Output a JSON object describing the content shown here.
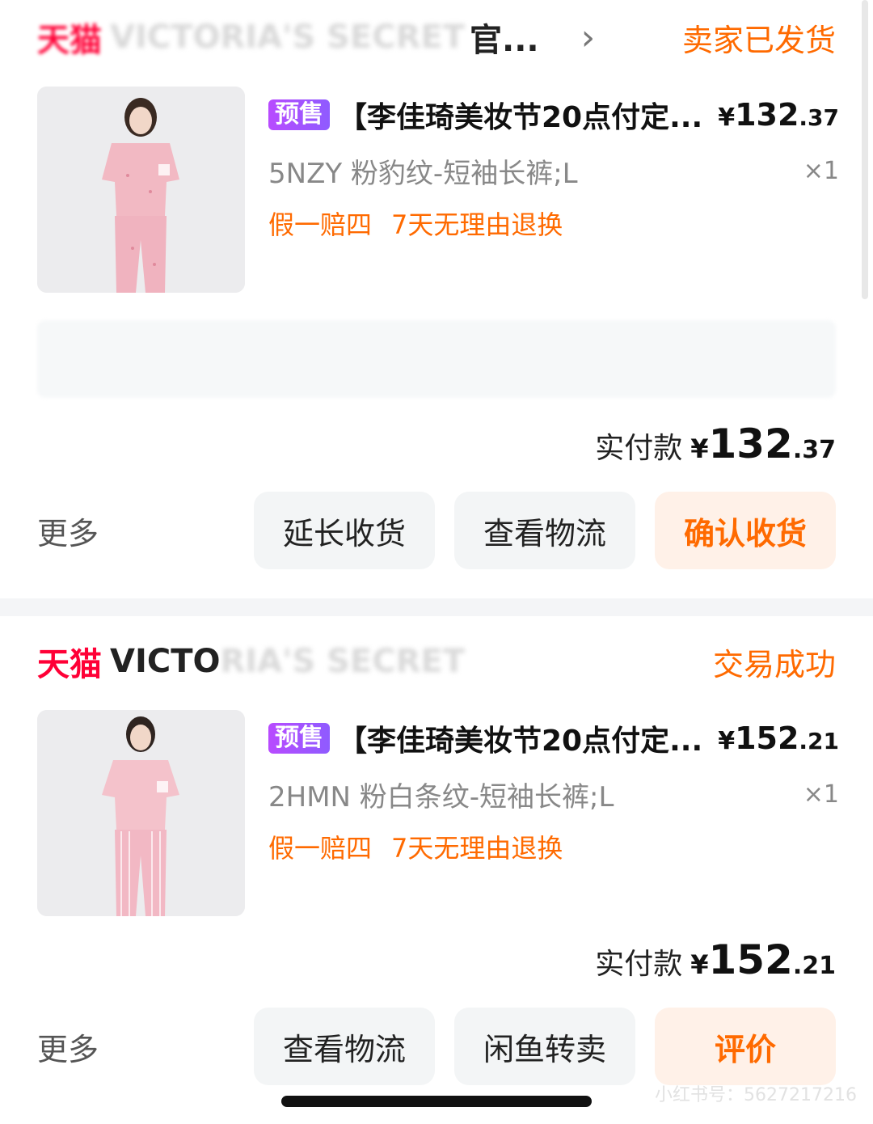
{
  "orders": [
    {
      "shop_prefix": "天猫",
      "shop_name_visible": "",
      "shop_name_blurred": "VICTORIA'S SECRET",
      "shop_suffix": "官...",
      "status": "卖家已发货",
      "product": {
        "badge": "预售",
        "title": "【李佳琦美妆节20点付定...",
        "price_currency": "¥",
        "price_int": "132",
        "price_dec": ".37",
        "sku": "5NZY 粉豹纹-短袖长裤;L",
        "qty": "×1",
        "tags": [
          "假一赔四",
          "7天无理由退换"
        ]
      },
      "paid": {
        "label": "实付款",
        "currency": "¥",
        "int": "132",
        "dec": ".37"
      },
      "more": "更多",
      "buttons": [
        "延长收货",
        "查看物流",
        "确认收货"
      ]
    },
    {
      "shop_prefix": "天猫",
      "shop_name_visible": "VICTO",
      "shop_name_blurred": "RIA'S SECRET",
      "shop_suffix": "",
      "status": "交易成功",
      "product": {
        "badge": "预售",
        "title": "【李佳琦美妆节20点付定...",
        "price_currency": "¥",
        "price_int": "152",
        "price_dec": ".21",
        "sku": "2HMN 粉白条纹-短袖长裤;L",
        "qty": "×1",
        "tags": [
          "假一赔四",
          "7天无理由退换"
        ]
      },
      "paid": {
        "label": "实付款",
        "currency": "¥",
        "int": "152",
        "dec": ".21"
      },
      "more": "更多",
      "buttons": [
        "查看物流",
        "闲鱼转卖",
        "评价"
      ]
    }
  ],
  "watermark": "小红书号：5627217216",
  "colors": {
    "accent": "#ff6a00",
    "tmall": "#ff0036",
    "presale": "#9b4dff"
  }
}
